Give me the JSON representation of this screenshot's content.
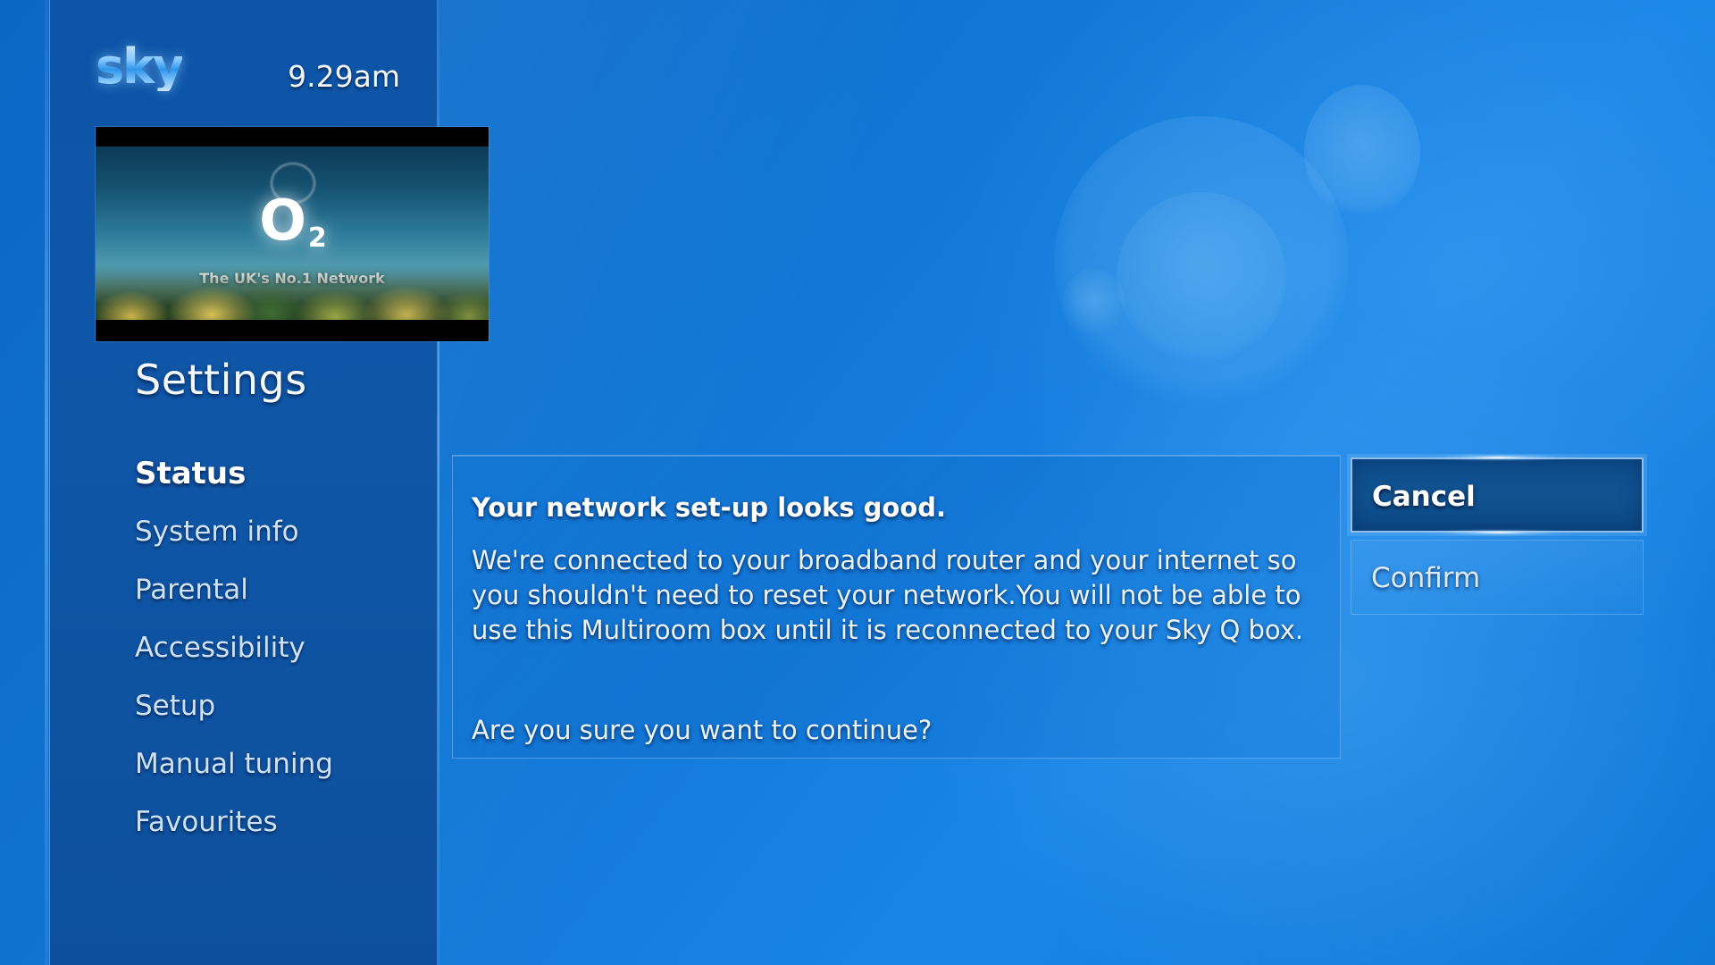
{
  "brand": {
    "logo_text": "sky",
    "clock": "9.29am"
  },
  "promo": {
    "logo": "O",
    "logo_sub": "2",
    "tagline": "The UK's No.1 Network"
  },
  "sidebar": {
    "title": "Settings",
    "items": [
      {
        "label": "Status",
        "selected": true
      },
      {
        "label": "System info",
        "selected": false
      },
      {
        "label": "Parental",
        "selected": false
      },
      {
        "label": "Accessibility",
        "selected": false
      },
      {
        "label": "Setup",
        "selected": false
      },
      {
        "label": "Manual tuning",
        "selected": false
      },
      {
        "label": "Favourites",
        "selected": false
      }
    ]
  },
  "dialog": {
    "heading": "Your network set-up looks good.",
    "body": "We're connected to your broadband router and your internet so you shouldn't need to reset your network.You will not be able to use this Multiroom box until it is reconnected to your Sky Q box.",
    "question": "Are you sure you want to continue?"
  },
  "buttons": [
    {
      "label": "Cancel",
      "selected": true
    },
    {
      "label": "Confirm",
      "selected": false
    }
  ],
  "colors": {
    "background_blue": "#1079d8",
    "sidebar_blue": "#0d55a8",
    "selected_button": "#0e4d8e",
    "text_white": "#ffffff",
    "text_muted": "#cfe2f5"
  }
}
